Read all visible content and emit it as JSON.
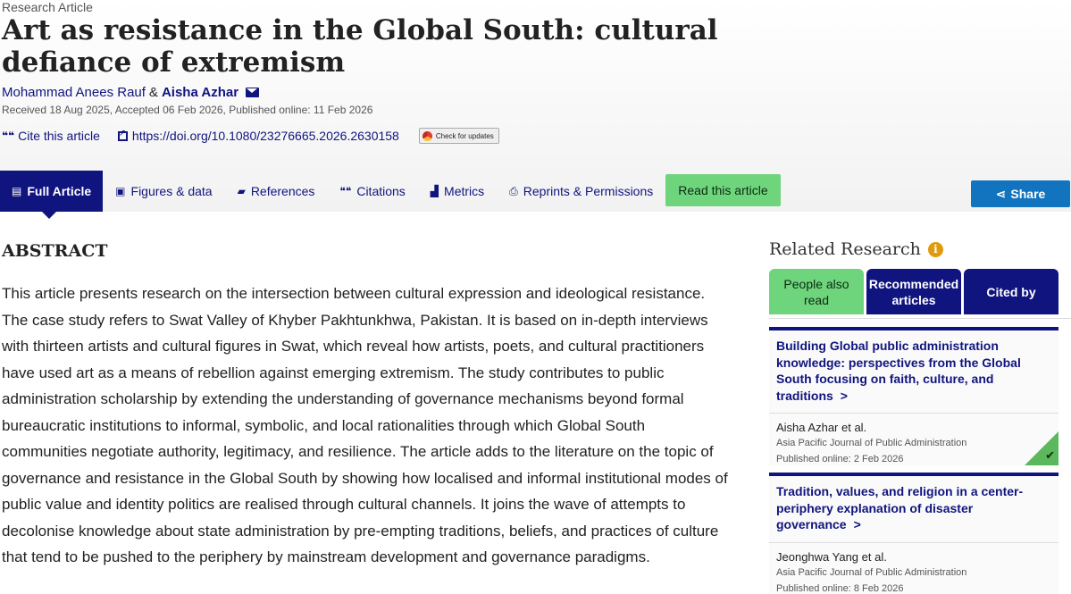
{
  "article": {
    "type": "Research Article",
    "title": "Art as resistance in the Global South: cultural defiance of extremism",
    "author1": "Mohammad Anees Rauf",
    "amp": "&",
    "author2": "Aisha Azhar",
    "dates": "Received 18 Aug 2025, Accepted 06 Feb 2026, Published online: 11 Feb 2026",
    "cite_label": "Cite this article",
    "doi": "https://doi.org/10.1080/23276665.2026.2630158",
    "check_updates": "Check for updates"
  },
  "tabs": {
    "full_article": "Full Article",
    "figures": "Figures & data",
    "references": "References",
    "citations": "Citations",
    "metrics": "Metrics",
    "reprints": "Reprints & Permissions",
    "read": "Read this article",
    "share": "Share"
  },
  "abstract": {
    "heading": "ABSTRACT",
    "text": "This article presents research on the intersection between cultural expression and ideological resistance. The case study refers to Swat Valley of Khyber Pakhtunkhwa, Pakistan. It is based on in-depth interviews with thirteen artists and cultural figures in Swat, which reveal how artists, poets, and cultural practitioners have used art as a means of rebellion against emerging extremism. The study contributes to public administration scholarship by extending the understanding of governance mechanisms beyond formal bureaucratic institutions to informal, symbolic, and local rationalities through which Global South communities negotiate authority, legitimacy, and resilience. The article adds to the literature on the topic of governance and resistance in the Global South by showing how localised and informal institutional modes of public value and identity politics are realised through cultural channels. It joins the wave of attempts to decolonise knowledge about state administration by pre-empting traditions, beliefs, and practices of culture that tend to be pushed to the periphery by mainstream development and governance paradigms."
  },
  "related": {
    "heading": "Related Research",
    "tabs": [
      "People also read",
      "Recommended articles",
      "Cited by"
    ],
    "items": [
      {
        "title": "Building Global public administration knowledge: perspectives from the Global South focusing on faith, culture, and traditions",
        "authors": "Aisha Azhar et al.",
        "journal": "Asia Pacific Journal of Public Administration",
        "published": "Published online: 2 Feb 2026"
      },
      {
        "title": "Tradition, values, and religion in a center-periphery explanation of disaster governance",
        "authors": "Jeonghwa Yang et al.",
        "journal": "Asia Pacific Journal of Public Administration",
        "published": "Published online: 8 Feb 2026"
      }
    ]
  },
  "icons": {
    "full_article": "document-icon",
    "figures": "image-icon",
    "references": "book-icon",
    "citations": "quote-icon",
    "metrics": "bar-chart-icon",
    "reprints": "printer-icon",
    "share": "share-icon",
    "info": "info-icon",
    "mail": "envelope-icon",
    "check": "checkmark-icon"
  },
  "colors": {
    "brand_navy": "#10147e",
    "accent_green": "#6fd57d",
    "share_blue": "#1273bf",
    "info_orange": "#e09a0d"
  }
}
